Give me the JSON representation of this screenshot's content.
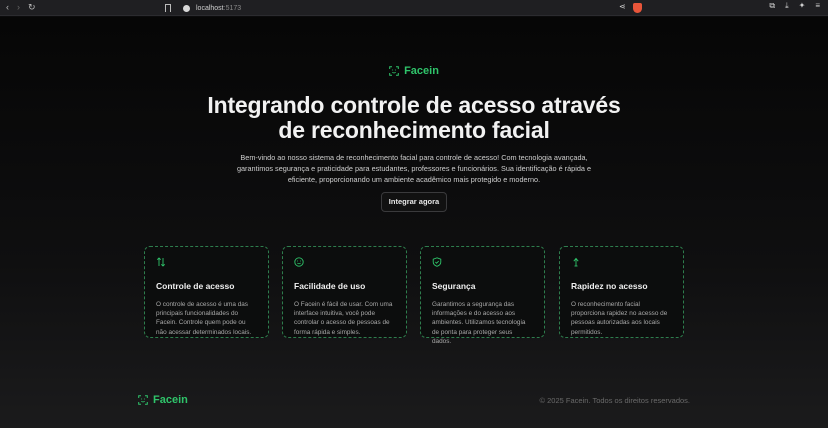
{
  "browser": {
    "url_host": "localhost",
    "url_port": ":5173"
  },
  "brand": {
    "name": "Facein",
    "accent": "#2fc46a"
  },
  "hero": {
    "title_line1": "Integrando controle de acesso através",
    "title_line2": "de reconhecimento facial",
    "description": "Bem-vindo ao nosso sistema de reconhecimento facial para controle de acesso! Com tecnologia avançada, garantimos segurança e praticidade para estudantes, professores e funcionários. Sua identificação é rápida e eficiente, proporcionando um ambiente acadêmico mais protegido e moderno.",
    "cta_label": "Integrar agora"
  },
  "features": [
    {
      "icon": "arrows-swap-icon",
      "title": "Controle de acesso",
      "text": "O controle de acesso é uma das principais funcionalidades do Facein. Controle quem pode ou não acessar determinados locais."
    },
    {
      "icon": "smile-icon",
      "title": "Facilidade de uso",
      "text": "O Facein é fácil de usar. Com uma interface intuitiva, você pode controlar o acesso de pessoas de forma rápida e simples."
    },
    {
      "icon": "shield-check-icon",
      "title": "Segurança",
      "text": "Garantimos a segurança das informações e do acesso aos ambientes. Utilizamos tecnologia de ponta para proteger seus dados."
    },
    {
      "icon": "arrow-up-icon",
      "title": "Rapidez no acesso",
      "text": "O reconhecimento facial proporciona rapidez no acesso de pessoas autorizadas aos locais permitidos."
    }
  ],
  "footer": {
    "copyright": "© 2025 Facein. Todos os direitos reservados."
  }
}
